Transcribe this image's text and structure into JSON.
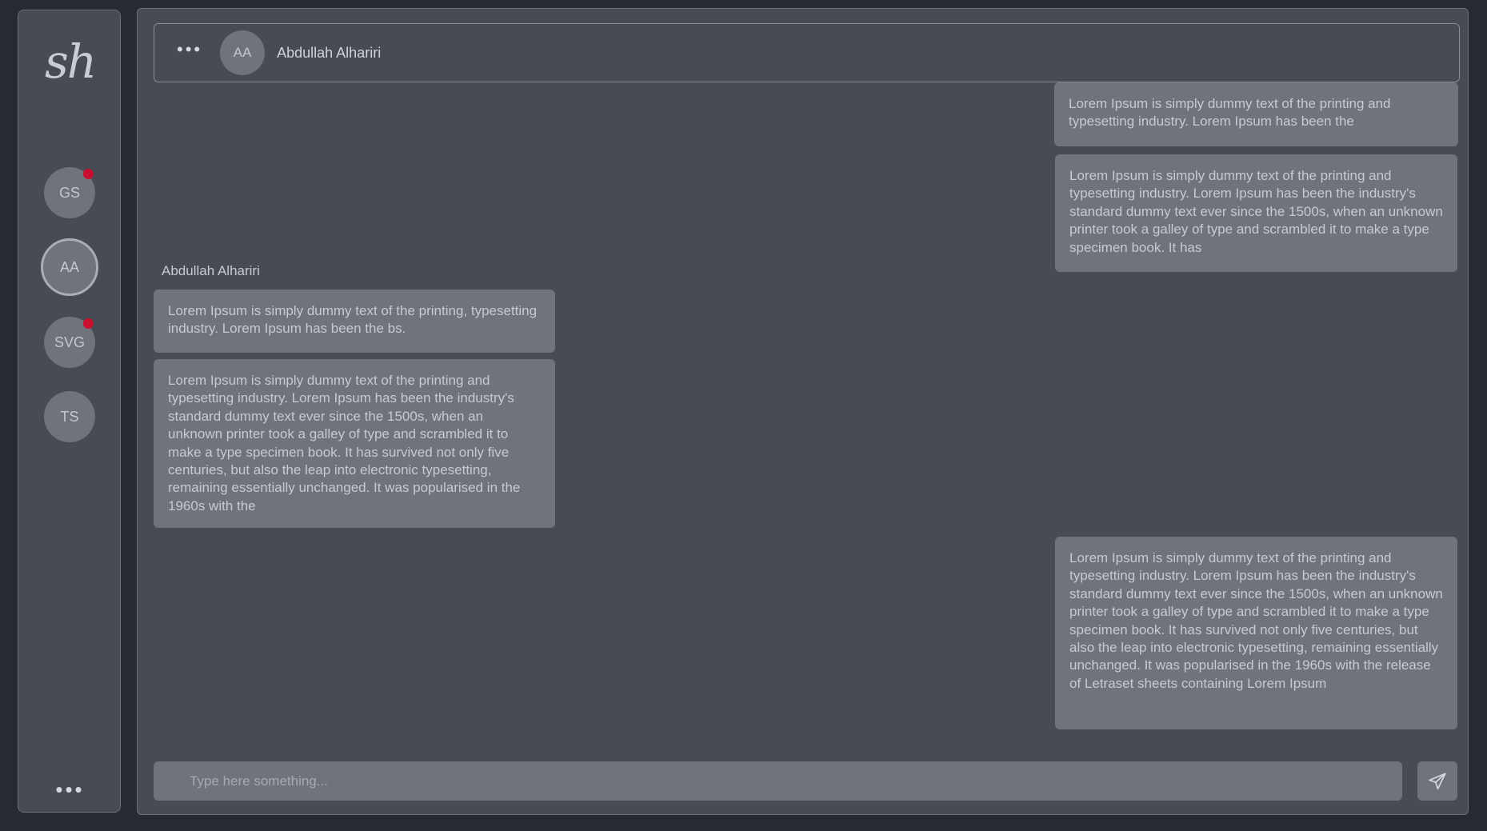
{
  "sidebar": {
    "logo": "sh",
    "avatars": [
      {
        "initials": "GS",
        "unread": true
      },
      {
        "initials": "AA",
        "unread": false,
        "active": true
      },
      {
        "initials": "SVG",
        "unread": true
      },
      {
        "initials": "TS",
        "unread": false
      }
    ],
    "more_label": "•••"
  },
  "header": {
    "more_label": "•••",
    "avatar_initials": "AA",
    "contact_name": "Abdullah Alhariri"
  },
  "conversation": {
    "sender_name": "Abdullah Alhariri",
    "messages": [
      {
        "side": "outgoing",
        "text": "Lorem Ipsum is simply dummy text of the printing and typesetting industry. Lorem Ipsum has been the"
      },
      {
        "side": "outgoing",
        "text": "Lorem Ipsum is simply dummy text of the printing and typesetting industry. Lorem Ipsum has been the industry's standard dummy text ever since the 1500s, when an unknown printer took a galley of type and scrambled it to make a type specimen book. It has"
      },
      {
        "side": "incoming",
        "text": "Lorem Ipsum is simply dummy text of the printing, typesetting industry. Lorem Ipsum has been the bs."
      },
      {
        "side": "incoming",
        "text": "Lorem Ipsum is simply dummy text of the printing and typesetting industry. Lorem Ipsum has been the industry's standard dummy text ever since the 1500s, when an unknown printer took a galley of type and scrambled it to make a type specimen book. It has survived not only five centuries, but also the leap into electronic typesetting, remaining essentially unchanged. It was popularised in the 1960s with the"
      },
      {
        "side": "outgoing",
        "text": "Lorem Ipsum is simply dummy text of the printing and typesetting industry. Lorem Ipsum has been the industry's standard dummy text ever since the 1500s, when an unknown printer took a galley of type and scrambled it to make a type specimen book. It has survived not only five centuries, but also the leap into electronic typesetting, remaining essentially unchanged. It was popularised in the 1960s with the release of Letraset sheets containing Lorem Ipsum"
      }
    ]
  },
  "composer": {
    "placeholder": "Type here something...",
    "value": "",
    "send_icon": "send-icon"
  },
  "colors": {
    "background": "#272a30",
    "panel": "#474b54",
    "bubble": "#6f737b",
    "unread_dot": "#c8102e"
  }
}
